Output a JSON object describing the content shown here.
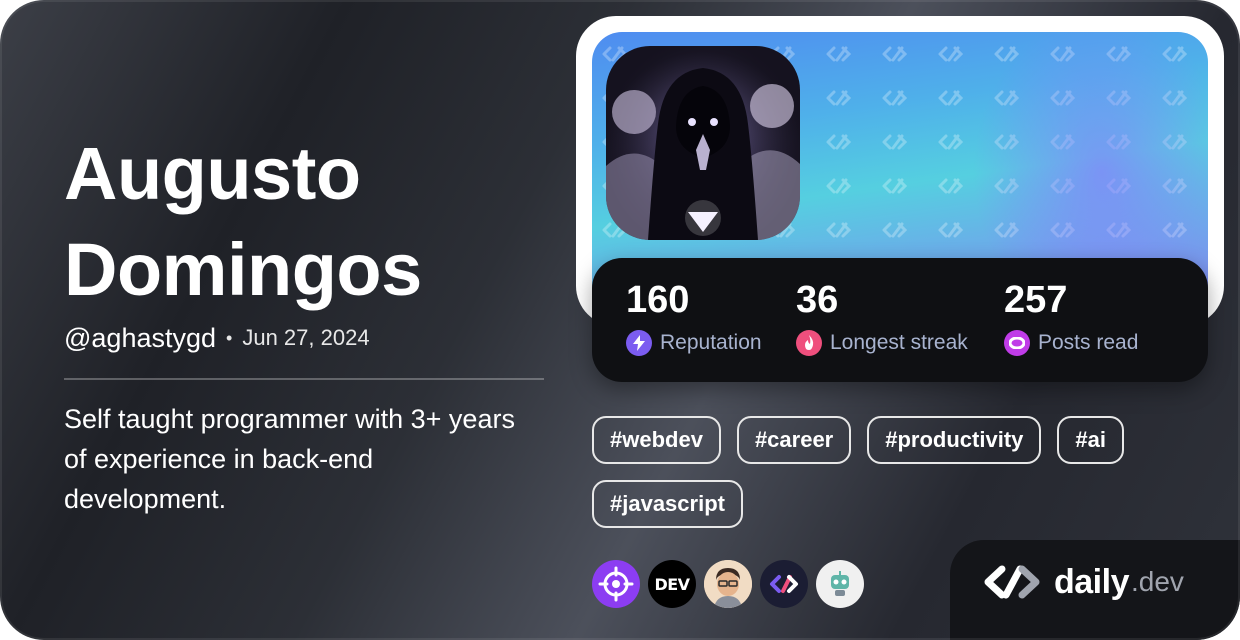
{
  "profile": {
    "first_name": "Augusto",
    "last_name": "Domingos",
    "handle": "@aghastygd",
    "separator": "•",
    "joined": "Jun 27, 2024",
    "bio": "Self taught programmer with 3+ years of experience in back-end development."
  },
  "stats": [
    {
      "value": "160",
      "label": "Reputation",
      "icon": "lightning-icon",
      "color": "#7b5cf0"
    },
    {
      "value": "36",
      "label": "Longest streak",
      "icon": "flame-icon",
      "color": "#ef4f7d"
    },
    {
      "value": "257",
      "label": "Posts read",
      "icon": "eye-icon",
      "color": "#c03ce8"
    }
  ],
  "tags": [
    "#webdev",
    "#career",
    "#productivity",
    "#ai",
    "#javascript"
  ],
  "squads": [
    {
      "icon": "crosshair-icon",
      "color": "#8c3df2"
    },
    {
      "text": "DEV",
      "icon": "dev-logo-icon",
      "color": "#000000"
    },
    {
      "icon": "memoji-avatar-icon",
      "color": "#e8c9a6"
    },
    {
      "icon": "daily-dev-squad-icon",
      "color": "#1b1d33"
    },
    {
      "icon": "robot-icon",
      "color": "#f0f0f0"
    }
  ],
  "brand": {
    "name": "daily",
    "suffix": ".dev"
  },
  "colors": {
    "accent_purple": "#7b5cf0",
    "accent_pink": "#ef4f7d",
    "accent_magenta": "#c03ce8",
    "stat_label": "#a8b3cf"
  }
}
